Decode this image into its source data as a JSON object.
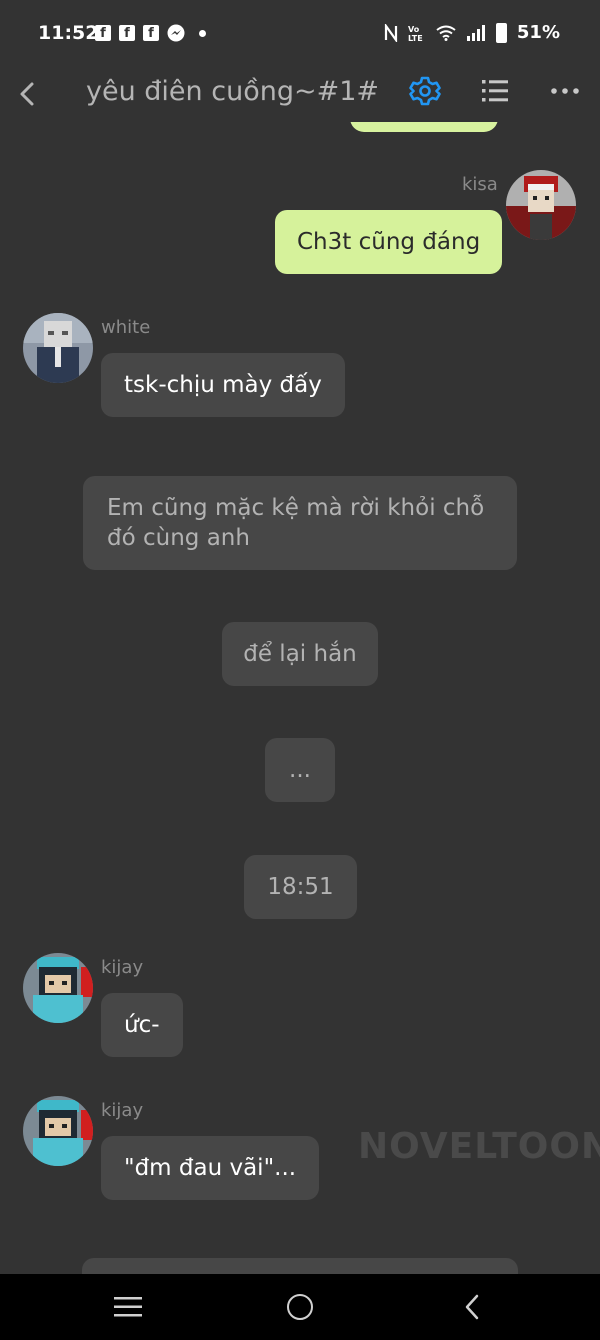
{
  "status_bar": {
    "time": "11:52",
    "battery": "51%",
    "icons": [
      "facebook-icon",
      "facebook-icon",
      "facebook-icon",
      "messenger-icon",
      "notification-dot",
      "nfc-icon",
      "volte-icon",
      "wifi-icon",
      "signal-icon",
      "battery-icon"
    ]
  },
  "header": {
    "title": "yêu điên cuồng~#1#",
    "accent_color": "#2196f3",
    "icons": [
      "back-arrow-icon",
      "gear-icon",
      "list-icon",
      "more-icon"
    ]
  },
  "messages": {
    "kisa_name": "kisa",
    "kisa_text": "Ch3t cũng đáng",
    "white_name": "white",
    "white_text": "tsk-chịu mày đấy",
    "narration_1": "Em cũng mặc kệ mà rời khỏi chỗ đó cùng anh",
    "narration_2": "để lại hắn",
    "narration_3": "...",
    "narration_4": "18:51",
    "kijay_name_1": "kijay",
    "kijay_text_1": "ức-",
    "kijay_name_2": "kijay",
    "kijay_text_2": "\"đm đau vãi\"..."
  },
  "watermark": "NOVELTOON",
  "colors": {
    "background": "#333333",
    "my_bubble": "#d6f29b",
    "other_bubble": "#474747"
  }
}
